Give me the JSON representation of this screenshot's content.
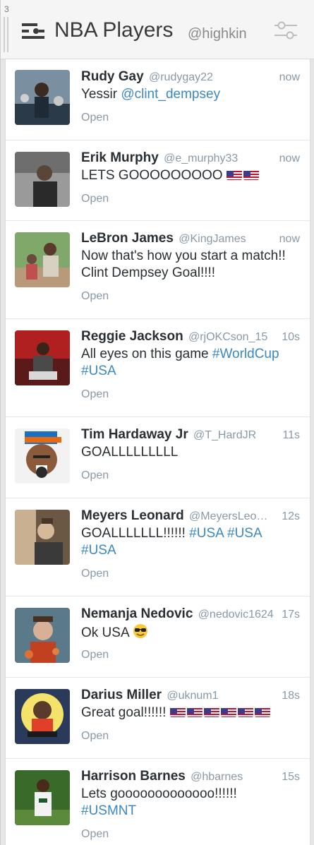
{
  "column": {
    "index": "3",
    "title": "NBA Players",
    "handle": "@highkin"
  },
  "tweets": [
    {
      "name": "Rudy Gay",
      "handle": "@rudygay22",
      "time": "now",
      "text": "Yessir ",
      "link": "@clint_dempsey",
      "open": "Open"
    },
    {
      "name": "Erik Murphy",
      "handle": "@e_murphy33",
      "time": "now",
      "text": "LETS GOOOOOOOOO",
      "flags": 2,
      "open": "Open"
    },
    {
      "name": "LeBron James",
      "handle": "@KingJames",
      "time": "now",
      "text": "Now that's how you start a match!! Clint Dempsey Goal!!!!",
      "open": "Open"
    },
    {
      "name": "Reggie Jackson",
      "handle": "@rjOKCson_15",
      "time": "10s",
      "text": "All eyes on this game ",
      "link": "#WorldCup",
      "link2": "#USA",
      "open": "Open"
    },
    {
      "name": "Tim Hardaway Jr",
      "handle": "@T_HardJR",
      "time": "11s",
      "text": "GOALLLLLLLLL",
      "open": "Open"
    },
    {
      "name": "Meyers Leonard",
      "handle": "@MeyersLeo…",
      "time": "12s",
      "text": "GOALLLLLLL!!!!!! ",
      "link": "#USA #USA",
      "link2": "#USA",
      "open": "Open"
    },
    {
      "name": "Nemanja Nedovic",
      "handle": "@nedovic1624",
      "time": "17s",
      "text": "Ok USA",
      "emoji": "sunglasses-face",
      "open": "Open"
    },
    {
      "name": "Darius Miller",
      "handle": "@uknum1",
      "time": "18s",
      "text": "Great goal!!!!!!",
      "flags": 6,
      "open": "Open"
    },
    {
      "name": "Harrison Barnes",
      "handle": "@hbarnes",
      "time": "15s",
      "text": "Lets gooooooooooooo!!!!!!",
      "link2": "#USMNT",
      "open": "Open"
    }
  ],
  "icons": {
    "column": "list-filter-icon",
    "settings": "sliders-icon",
    "flag": "us-flag-emoji"
  },
  "colors": {
    "link": "#3b88c3",
    "muted": "#8899a6"
  }
}
